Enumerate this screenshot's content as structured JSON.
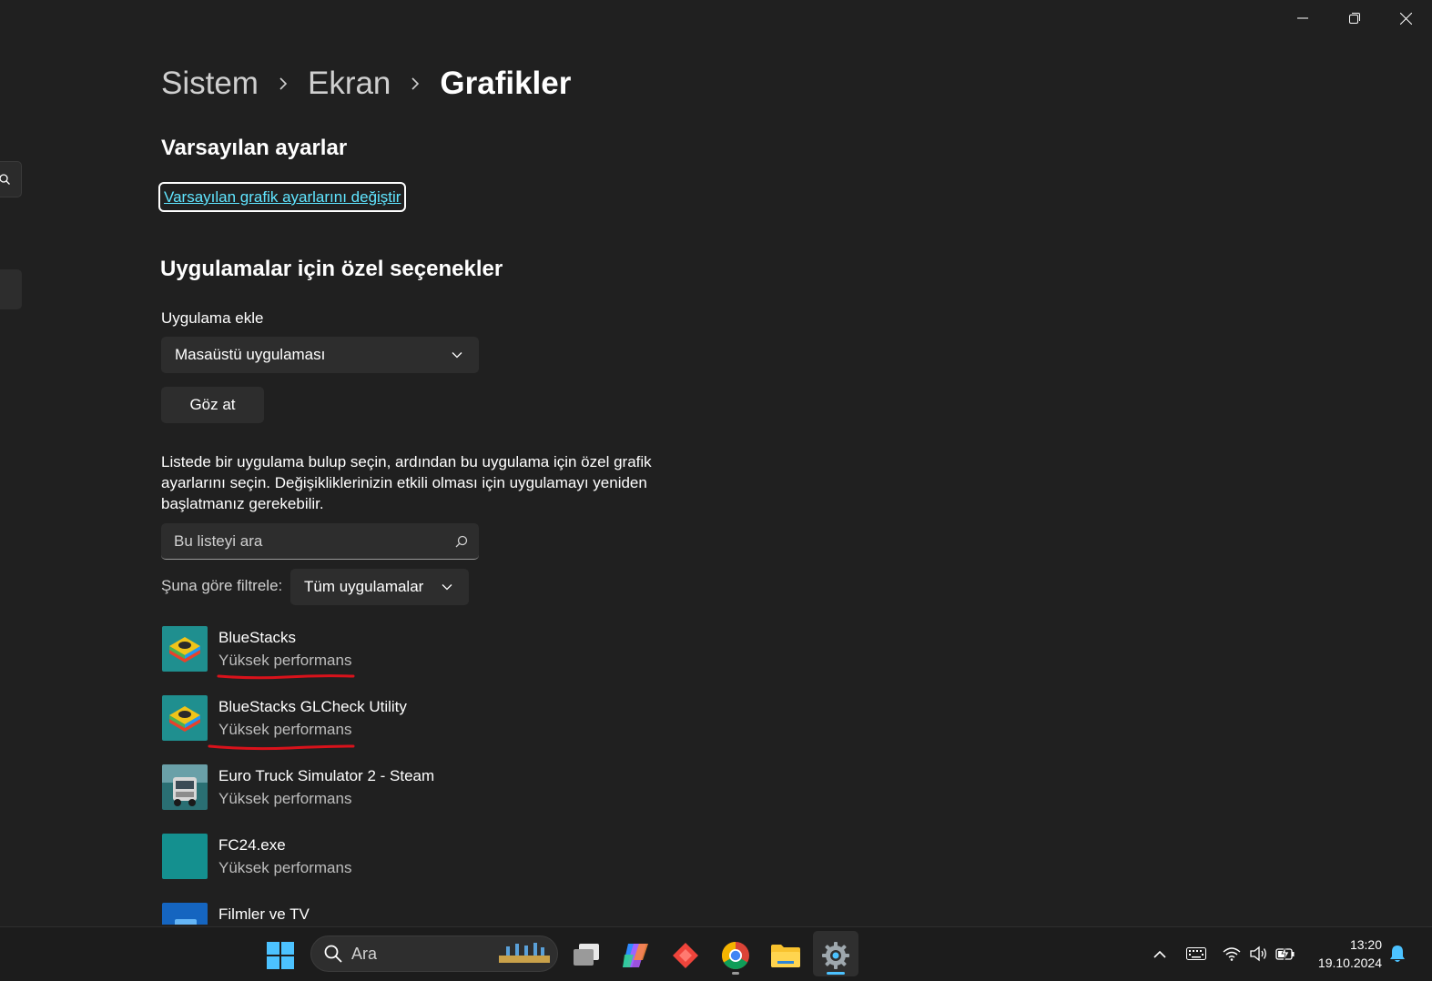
{
  "breadcrumb": {
    "items": [
      "Sistem",
      "Ekran"
    ],
    "current": "Grafikler"
  },
  "defaults": {
    "title": "Varsayılan ayarlar",
    "link": "Varsayılan grafik ayarlarını değiştir"
  },
  "custom": {
    "title": "Uygulamalar için özel seçenekler",
    "add_label": "Uygulama ekle",
    "app_type_selected": "Masaüstü uygulaması",
    "browse_button": "Göz at",
    "description": "Listede bir uygulama bulup seçin, ardından bu uygulama için özel grafik ayarlarını seçin. Değişikliklerinizin etkili olması için uygulamayı yeniden başlatmanız gerekebilir.",
    "search_placeholder": "Bu listeyi ara",
    "filter_label": "Şuna göre filtrele:",
    "filter_selected": "Tüm uygulamalar"
  },
  "apps": [
    {
      "name": "BlueStacks",
      "status": "Yüksek performans",
      "icon": "bluestacks-icon"
    },
    {
      "name": "BlueStacks GLCheck Utility",
      "status": "Yüksek performans",
      "icon": "bluestacks-icon"
    },
    {
      "name": "Euro Truck Simulator 2 - Steam",
      "status": "Yüksek performans",
      "icon": "truck-icon"
    },
    {
      "name": "FC24.exe",
      "status": "Yüksek performans",
      "icon": "generic-app-icon"
    },
    {
      "name": "Filmler ve TV",
      "status": "",
      "icon": "movies-tv-icon"
    }
  ],
  "taskbar": {
    "search_text": "Ara",
    "time": "13:20",
    "date": "19.10.2024"
  },
  "colors": {
    "background": "#202020",
    "card": "#2d2d2d",
    "link": "#60e5ff",
    "annotation": "#d9121b",
    "accent": "#4cc2ff"
  }
}
